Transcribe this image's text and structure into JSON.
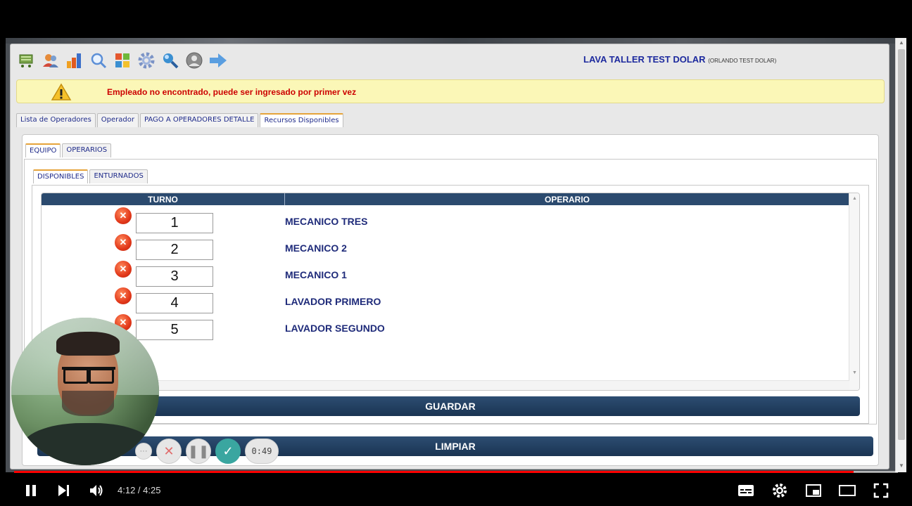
{
  "app": {
    "company_name": "LAVA TALLER TEST DOLAR",
    "company_sub": "(ORLANDO TEST DOLAR)",
    "toolbar_icons": [
      "cart-icon",
      "users-icon",
      "bar-chart-icon",
      "search-icon",
      "windows-icon",
      "gear-icon",
      "magnifier-icon",
      "user-circle-icon",
      "arrow-right-icon"
    ]
  },
  "alert": {
    "message": "Empleado no encontrado, puede ser ingresado por primer vez",
    "icon": "warning-icon"
  },
  "main_tabs": [
    {
      "label": "Lista de Operadores"
    },
    {
      "label": "Operador"
    },
    {
      "label": "PAGO A OPERADORES DETALLE"
    },
    {
      "label": "Recursos Disponibles"
    }
  ],
  "sub_tabs": [
    {
      "label": "EQUIPO"
    },
    {
      "label": "OPERARIOS"
    }
  ],
  "inner_tabs": [
    {
      "label": "DISPONIBLES"
    },
    {
      "label": "ENTURNADOS"
    }
  ],
  "grid": {
    "col_turno": "TURNO",
    "col_operario": "OPERARIO",
    "rows": [
      {
        "turno": "1",
        "operario": "MECANICO TRES"
      },
      {
        "turno": "2",
        "operario": "MECANICO 2"
      },
      {
        "turno": "3",
        "operario": "MECANICO 1"
      },
      {
        "turno": "4",
        "operario": "LAVADOR PRIMERO"
      },
      {
        "turno": "5",
        "operario": "LAVADOR SEGUNDO"
      }
    ]
  },
  "buttons": {
    "save": "GUARDAR",
    "clear": "LIMPIAR"
  },
  "recorder": {
    "more": "···",
    "cancel": "✕",
    "pause": "❚❚",
    "done": "✓",
    "elapsed": "0:49"
  },
  "player": {
    "current_time": "4:12",
    "separator": " / ",
    "duration": "4:25",
    "progress_fraction": 0.95,
    "accent_color": "#ff0000"
  }
}
